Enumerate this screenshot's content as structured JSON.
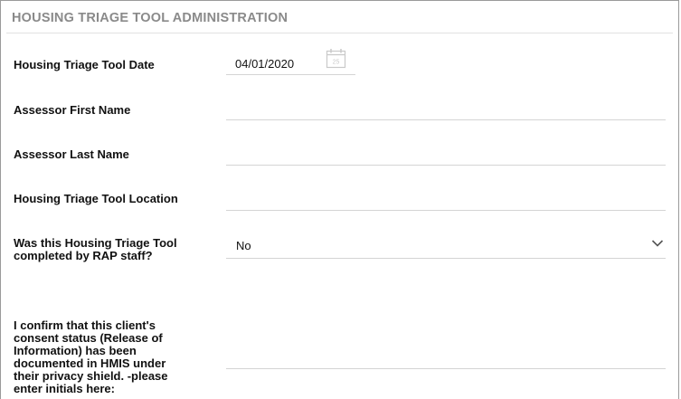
{
  "section": {
    "title": "HOUSING TRIAGE TOOL ADMINISTRATION"
  },
  "fields": {
    "triage_date": {
      "label": "Housing Triage Tool Date",
      "value": "04/01/2020",
      "icon": "calendar-icon",
      "icon_day": "25"
    },
    "assessor_first_name": {
      "label": "Assessor First Name",
      "value": ""
    },
    "assessor_last_name": {
      "label": "Assessor Last Name",
      "value": ""
    },
    "location": {
      "label": "Housing Triage Tool Location",
      "value": ""
    },
    "rap_staff": {
      "label_line1": "Was this Housing Triage Tool",
      "label_line2": "completed by RAP staff?",
      "value": "No",
      "icon": "chevron-down-icon"
    },
    "consent": {
      "label_lines": [
        "I confirm that this client's",
        "consent status (Release of",
        "Information) has been",
        "documented in HMIS under",
        "their privacy shield. -please",
        "enter initials here:"
      ],
      "value": ""
    }
  },
  "colors": {
    "title": "#8a8a8a",
    "rule": "#d4d4d4",
    "icon": "#c9c9c9"
  }
}
